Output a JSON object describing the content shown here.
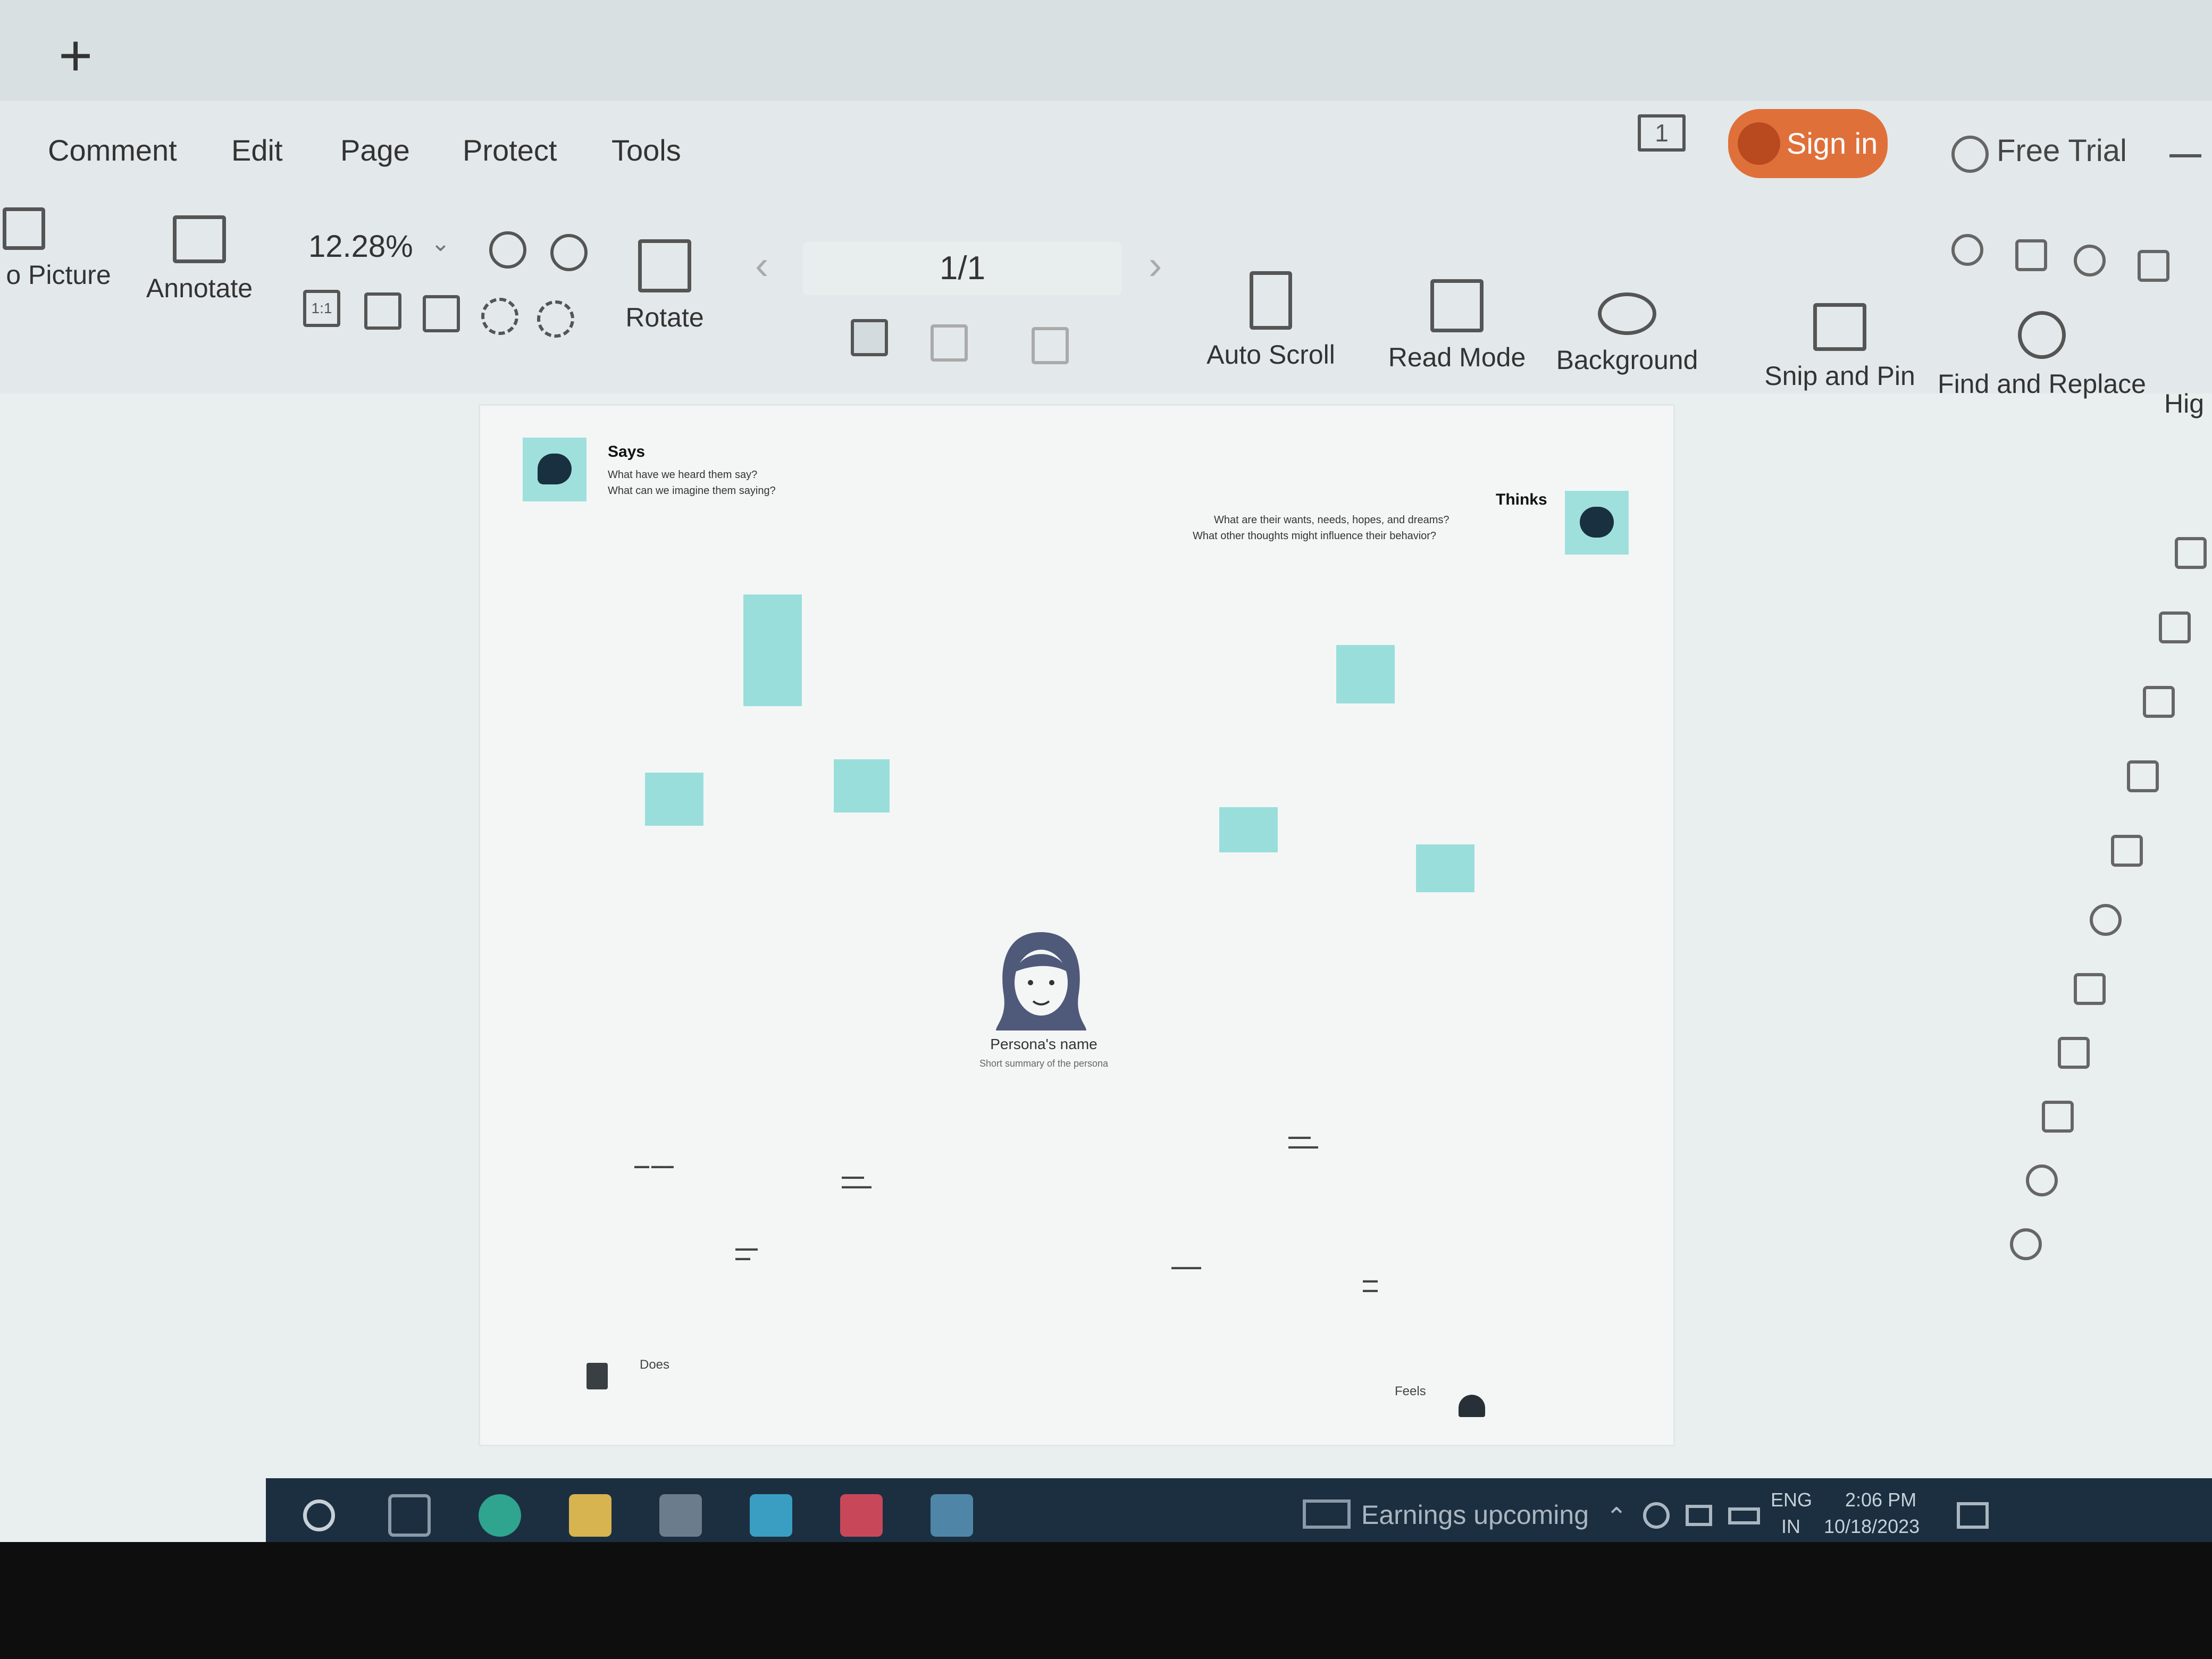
{
  "tabstrip": {
    "new_tab_icon": "+"
  },
  "menu": {
    "items": [
      "Comment",
      "Edit",
      "Page",
      "Protect",
      "Tools"
    ]
  },
  "header": {
    "page_view_label": "1",
    "sign_in_label": "Sign in",
    "free_trial_label": "Free Trial",
    "colors": {
      "sign_in_bg": "#e0703a"
    }
  },
  "toolbar": {
    "to_picture_label": "o Picture",
    "annotate_label": "Annotate",
    "zoom_value": "12.28%",
    "actual_size_label": "1:1",
    "rotate_label": "Rotate",
    "page_counter": "1/1",
    "auto_scroll_label": "Auto Scroll",
    "read_mode_label": "Read Mode",
    "background_label": "Background",
    "snip_pin_label": "Snip and Pin",
    "find_replace_label": "Find and Replace",
    "highlight_label": "Hig"
  },
  "document": {
    "says": {
      "title": "Says",
      "sub1": "What have we heard them say?",
      "sub2": "What can we imagine them saying?"
    },
    "thinks": {
      "title": "Thinks",
      "sub1": "What are their wants, needs, hopes, and dreams?",
      "sub2": "What other thoughts might influence their behavior?"
    },
    "does": {
      "title": "Does"
    },
    "feels": {
      "title": "Feels"
    },
    "persona": {
      "name": "Persona's name",
      "summary": "Short summary of the persona"
    }
  },
  "taskbar": {
    "earnings": "Earnings upcoming",
    "lang1": "ENG",
    "lang2": "IN",
    "time": "2:06 PM",
    "date": "10/18/2023"
  }
}
